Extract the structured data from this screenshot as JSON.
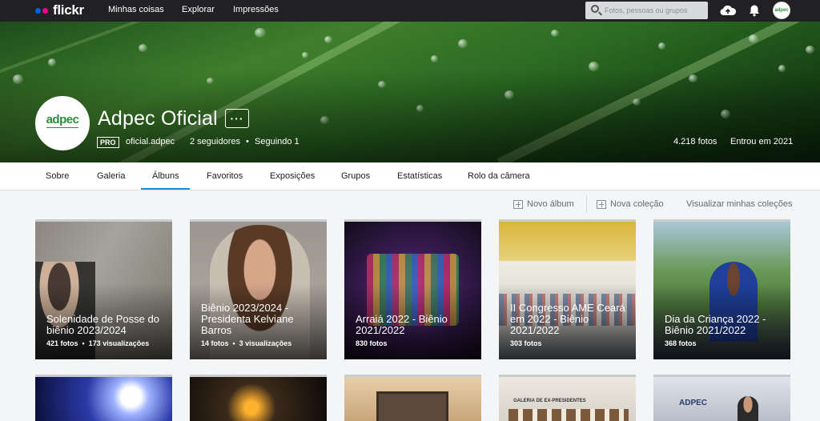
{
  "topbar": {
    "logo": "flickr",
    "nav": [
      "Minhas coisas",
      "Explorar",
      "Impressões"
    ],
    "search_placeholder": "Fotos, pessoas ou grupos",
    "avatar_text": "adpec"
  },
  "profile": {
    "avatar_text": "adpec",
    "name": "Adpec Oficial",
    "more_label": "···",
    "badge": "PRO",
    "username": "oficial.adpec",
    "followers": "2 seguidores",
    "following": "Seguindo 1",
    "photos": "4.218 fotos",
    "joined": "Entrou em 2021"
  },
  "tabs": [
    "Sobre",
    "Galeria",
    "Álbuns",
    "Favoritos",
    "Exposições",
    "Grupos",
    "Estatísticas",
    "Rolo da câmera"
  ],
  "active_tab": "Álbuns",
  "actions": {
    "new_album": "Novo álbum",
    "new_collection": "Nova coleção",
    "view_collections": "Visualizar minhas coleções"
  },
  "albums": [
    {
      "title": "Solenidade de Posse do biênio 2023/2024",
      "photos": "421 fotos",
      "views": "173 visualizações"
    },
    {
      "title": "Biênio 2023/2024 - Presidenta Kelviane Barros",
      "photos": "14 fotos",
      "views": "3 visualizações"
    },
    {
      "title": "Arraiá 2022 - Biênio 2021/2022",
      "photos": "830 fotos",
      "views": ""
    },
    {
      "title": "II Congresso AME Ceará em 2022 - Biênio 2021/2022",
      "photos": "303 fotos",
      "views": ""
    },
    {
      "title": "Dia da Criança 2022 - Biênio 2021/2022",
      "photos": "368 fotos",
      "views": ""
    }
  ],
  "second_row_texts": {
    "gallery_sign": "GALERIA DE EX-PRESIDENTES",
    "adpec_sign": "ADPEC"
  },
  "colors": {
    "topbar_bg": "#212124",
    "accent_blue": "#128fdc",
    "flickr_blue": "#0063dc",
    "flickr_pink": "#ff0084"
  }
}
